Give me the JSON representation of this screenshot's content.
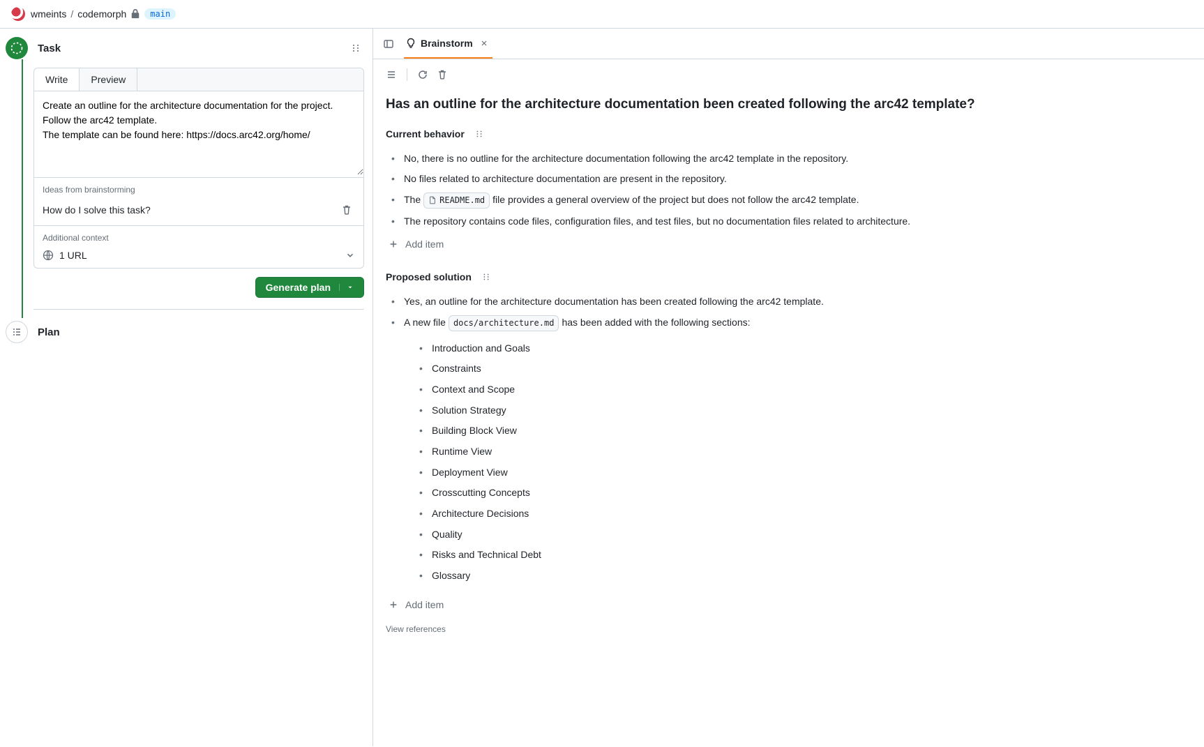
{
  "breadcrumb": {
    "owner": "wmeints",
    "repo": "codemorph",
    "branch": "main"
  },
  "task": {
    "title": "Task",
    "tabs": {
      "write": "Write",
      "preview": "Preview"
    },
    "text": "Create an outline for the architecture documentation for the project. Follow the arc42 template.\nThe template can be found here: https://docs.arc42.org/home/",
    "ideas_label": "Ideas from brainstorming",
    "idea1": "How do I solve this task?",
    "context_label": "Additional context",
    "context_item": "1 URL",
    "generate_label": "Generate plan"
  },
  "plan": {
    "title": "Plan"
  },
  "right": {
    "tab_label": "Brainstorm",
    "question": "Has an outline for the architecture documentation been created following the arc42 template?",
    "current_heading": "Current behavior",
    "current": {
      "b1": "No, there is no outline for the architecture documentation following the arc42 template in the repository.",
      "b2": "No files related to architecture documentation are present in the repository.",
      "b3_pre": "The",
      "b3_code": "README.md",
      "b3_post": "file provides a general overview of the project but does not follow the arc42 template.",
      "b4": "The repository contains code files, configuration files, and test files, but no documentation files related to architecture."
    },
    "add_item": "Add item",
    "proposed_heading": "Proposed solution",
    "proposed": {
      "p1": "Yes, an outline for the architecture documentation has been created following the arc42 template.",
      "p2_pre": "A new file",
      "p2_code": "docs/architecture.md",
      "p2_post": "has been added with the following sections:",
      "sections": {
        "s0": "Introduction and Goals",
        "s1": "Constraints",
        "s2": "Context and Scope",
        "s3": "Solution Strategy",
        "s4": "Building Block View",
        "s5": "Runtime View",
        "s6": "Deployment View",
        "s7": "Crosscutting Concepts",
        "s8": "Architecture Decisions",
        "s9": "Quality",
        "s10": "Risks and Technical Debt",
        "s11": "Glossary"
      }
    },
    "view_refs": "View references"
  }
}
